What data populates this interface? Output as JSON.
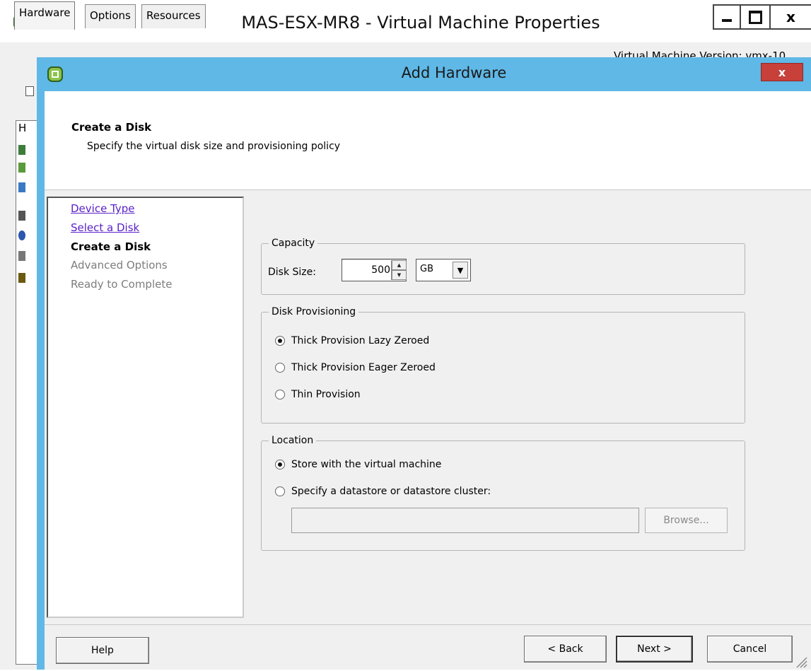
{
  "outer_window": {
    "title": "MAS-ESX-MR8 - Virtual Machine Properties",
    "controls": {
      "close": "x"
    },
    "tabs": [
      {
        "label": "Hardware",
        "active": true
      },
      {
        "label": "Options",
        "active": false
      },
      {
        "label": "Resources",
        "active": false
      }
    ],
    "vm_version": "Virtual Machine Version: vmx-10",
    "list_header_fragment": "H"
  },
  "dialog": {
    "title": "Add Hardware",
    "close": "x",
    "header": {
      "title": "Create a Disk",
      "subtitle": "Specify the virtual disk size and provisioning policy"
    },
    "steps": [
      {
        "label": "Device Type",
        "state": "link"
      },
      {
        "label": "Select a Disk",
        "state": "link"
      },
      {
        "label": "Create a Disk",
        "state": "current"
      },
      {
        "label": "Advanced Options",
        "state": "disabled"
      },
      {
        "label": "Ready to Complete",
        "state": "disabled"
      }
    ],
    "capacity": {
      "legend": "Capacity",
      "disk_size_label": "Disk Size:",
      "disk_size_value": "500",
      "unit": "GB"
    },
    "provisioning": {
      "legend": "Disk Provisioning",
      "options": [
        {
          "label": "Thick Provision Lazy Zeroed",
          "selected": true
        },
        {
          "label": "Thick Provision Eager Zeroed",
          "selected": false
        },
        {
          "label": "Thin Provision",
          "selected": false
        }
      ]
    },
    "location": {
      "legend": "Location",
      "options": [
        {
          "label": "Store with the virtual machine",
          "selected": true
        },
        {
          "label": "Specify a datastore or datastore cluster:",
          "selected": false
        }
      ],
      "datastore_value": "",
      "browse_label": "Browse..."
    },
    "buttons": {
      "help": "Help",
      "back": "< Back",
      "next": "Next >",
      "cancel": "Cancel"
    }
  },
  "colors": {
    "dialog_frame": "#5fb8e6",
    "close_red": "#c7403a",
    "link": "#5b21c9",
    "disabled_text": "#7d7d7d"
  }
}
